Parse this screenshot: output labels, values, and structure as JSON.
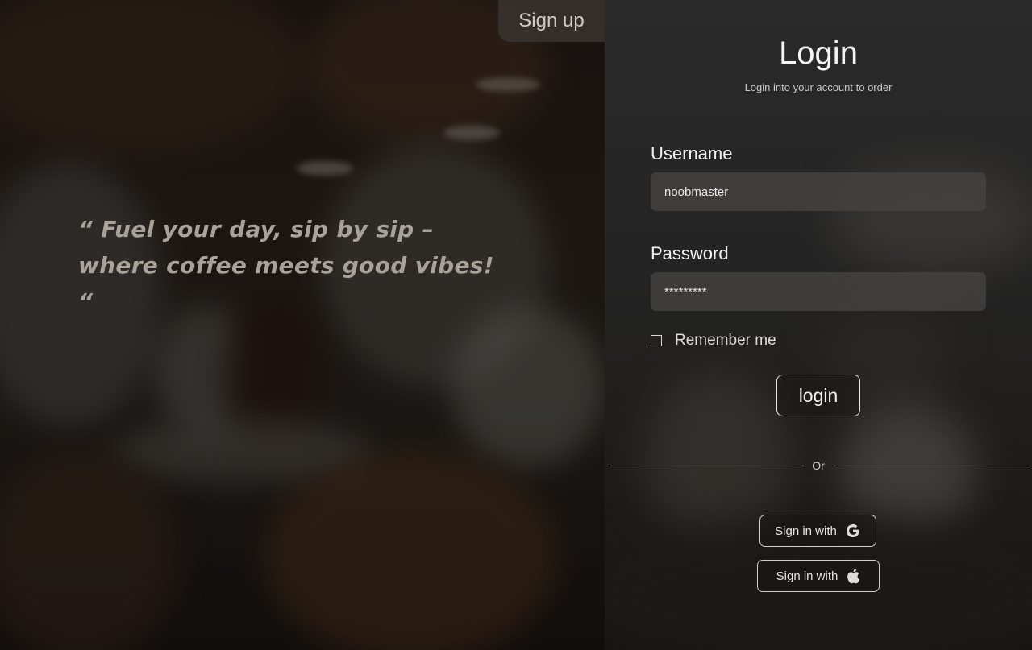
{
  "header": {
    "signup_label": "Sign up"
  },
  "hero": {
    "quote_line1": "“ Fuel your day, sip by sip –",
    "quote_line2": "where coffee meets good vibes! “"
  },
  "login": {
    "title": "Login",
    "subtitle": "Login into your account to order",
    "username_label": "Username",
    "username_value": "noobmaster",
    "password_label": "Password",
    "password_value": "*********",
    "remember_label": "Remember me",
    "login_button": "login",
    "divider_text": "Or",
    "google_button": "Sign in with",
    "apple_button": "Sign in with"
  },
  "icons": {
    "google": "google-icon",
    "apple": "apple-icon",
    "checkbox": "checkbox-unchecked"
  }
}
